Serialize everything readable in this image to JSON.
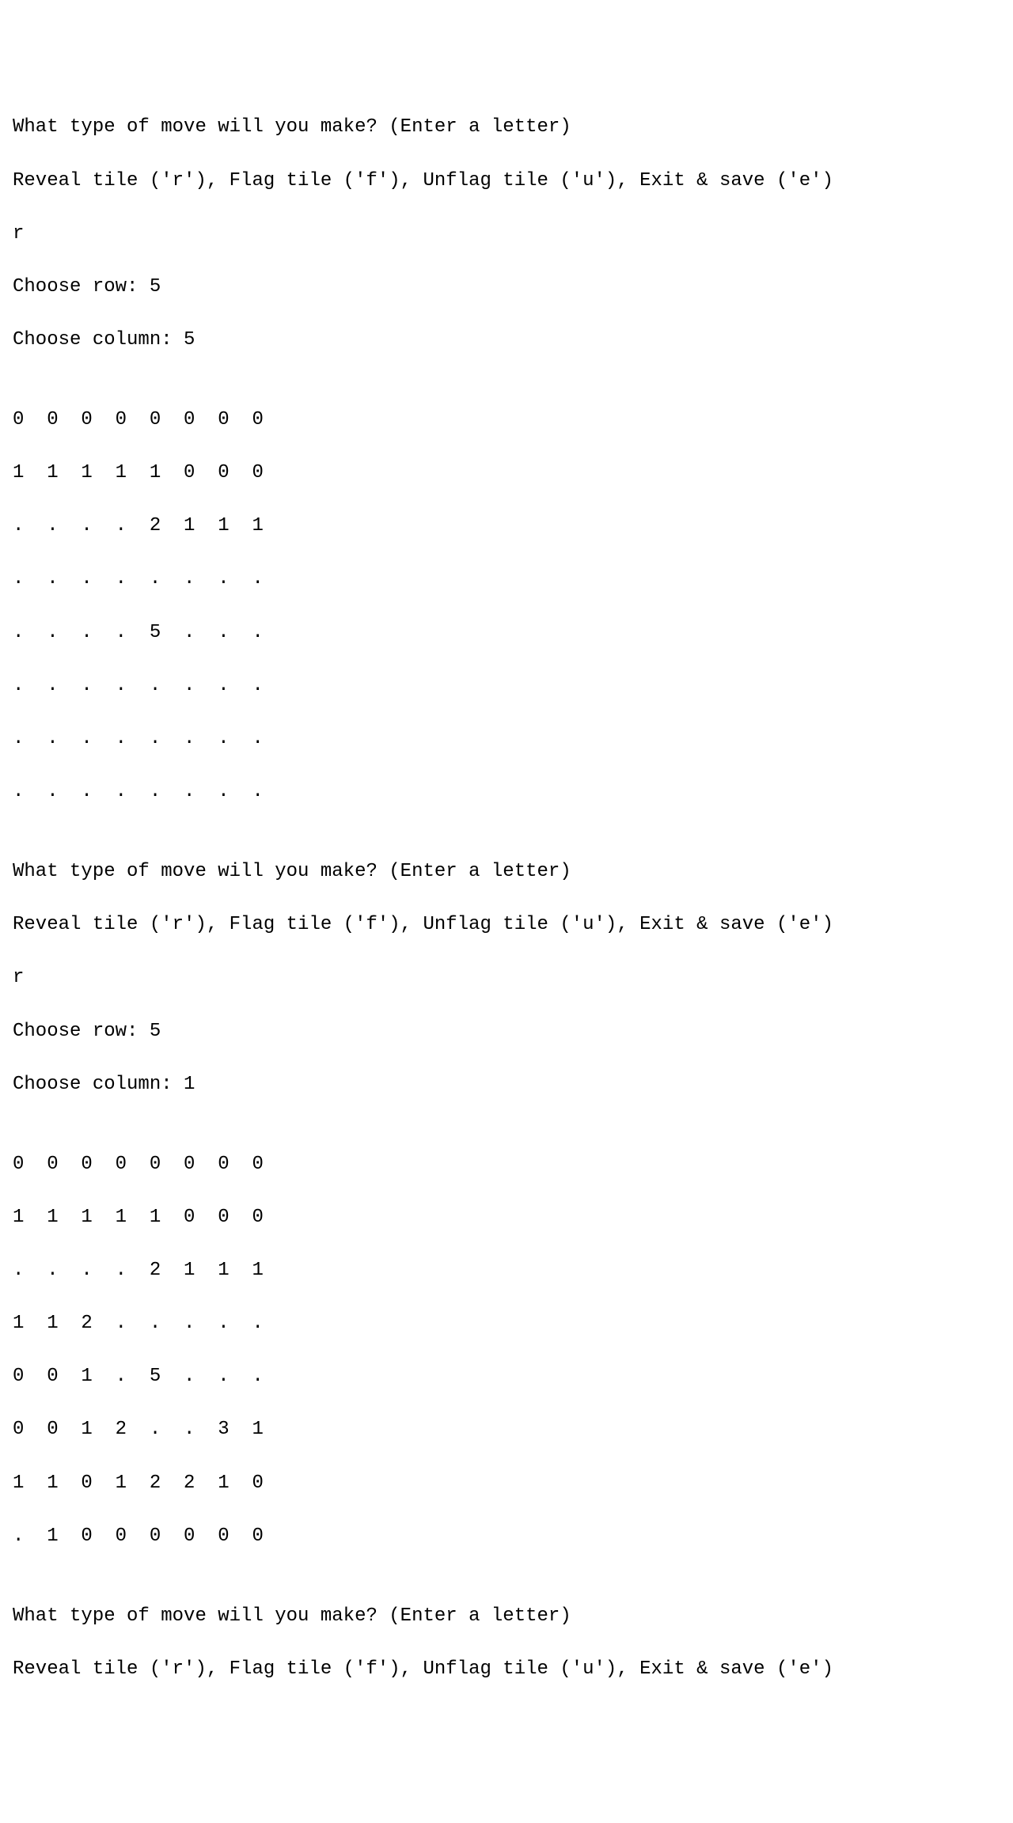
{
  "prompts": {
    "move_question": "What type of move will you make? (Enter a letter)",
    "options": "Reveal tile ('r'), Flag tile ('f'), Unflag tile ('u'), Exit & save ('e')",
    "choose_row_label": "Choose row: ",
    "choose_column_label": "Choose column: "
  },
  "turns": [
    {
      "input_move": "r",
      "input_row": "5",
      "input_column": "5",
      "board_rows": [
        "0  0  0  0  0  0  0  0",
        "1  1  1  1  1  0  0  0",
        ".  .  .  .  2  1  1  1",
        ".  .  .  .  .  .  .  .",
        ".  .  .  .  5  .  .  .",
        ".  .  .  .  .  .  .  .",
        ".  .  .  .  .  .  .  .",
        ".  .  .  .  .  .  .  ."
      ]
    },
    {
      "input_move": "r",
      "input_row": "5",
      "input_column": "1",
      "board_rows": [
        "0  0  0  0  0  0  0  0",
        "1  1  1  1  1  0  0  0",
        ".  .  .  .  2  1  1  1",
        "1  1  2  .  .  .  .  .",
        "0  0  1  .  5  .  .  .",
        "0  0  1  2  .  .  3  1",
        "1  1  0  1  2  2  1  0",
        ".  1  0  0  0  0  0  0"
      ]
    }
  ],
  "blank": ""
}
